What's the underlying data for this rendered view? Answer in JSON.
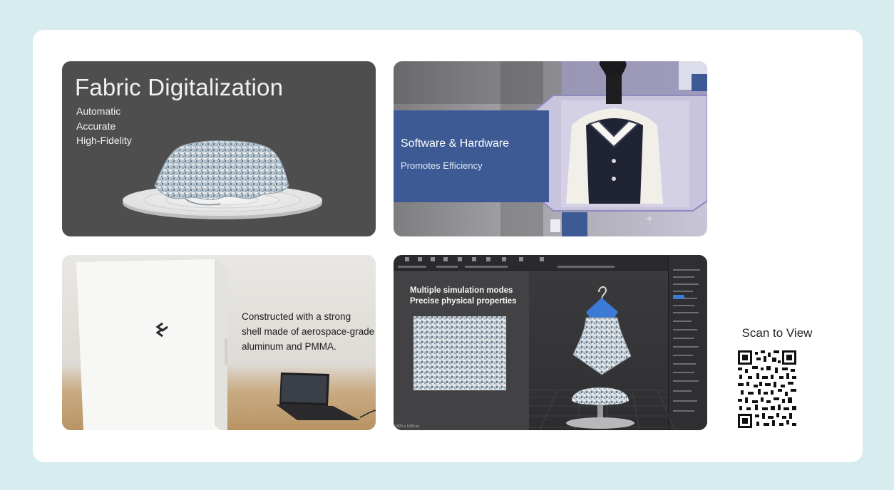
{
  "tiles": [
    {
      "title": "Fabric Digitalization",
      "features": [
        "Automatic",
        "Accurate",
        "High-Fidelity"
      ]
    },
    {
      "headline": "Software & Hardware",
      "subline": "Promotes Efficiency"
    },
    {
      "caption": [
        "Constructed with a strong",
        "shell made of aerospace-grade",
        "aluminum and PMMA."
      ],
      "logo": "S"
    },
    {
      "headline_lines": [
        "Multiple simulation modes",
        "Precise physical properties"
      ],
      "status": "1920 x 1080 px"
    }
  ],
  "qr": {
    "label": "Scan to View",
    "icon": "qr-code-icon"
  },
  "colors": {
    "background": "#d6ecef",
    "card": "#ffffff",
    "tile_dark": "#4e4e4e",
    "accent_blue": "#3d5a95",
    "hanger_blue": "#3d7ad6"
  }
}
